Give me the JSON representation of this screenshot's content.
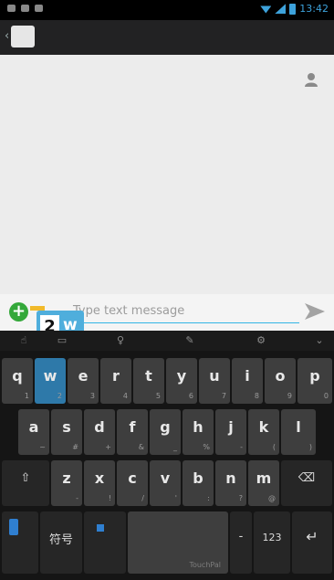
{
  "status_bar": {
    "time": "13:42",
    "icons": [
      "notification-icon",
      "image-icon",
      "sd-card-icon",
      "wifi-icon",
      "signal-icon",
      "battery-icon"
    ]
  },
  "action_bar": {
    "icons": [
      "back-chevron-icon",
      "messaging-app-icon"
    ]
  },
  "message_area": {
    "contact_icon": "contact-person-icon"
  },
  "compose": {
    "placeholder": "Type text message",
    "add_icon": "plus-icon",
    "send_icon": "send-icon",
    "attach_icon": "attachment-icon"
  },
  "key_popup": {
    "number": "2",
    "letter": "w"
  },
  "keyboard": {
    "toolbar_icons": [
      "cursor-icon",
      "layout-icon",
      "microphone-icon",
      "pencil-icon",
      "settings-icon",
      "hide-keyboard-icon"
    ],
    "row1": [
      {
        "main": "q",
        "sub": "1"
      },
      {
        "main": "w",
        "sub": "2"
      },
      {
        "main": "e",
        "sub": "3"
      },
      {
        "main": "r",
        "sub": "4"
      },
      {
        "main": "t",
        "sub": "5"
      },
      {
        "main": "y",
        "sub": "6"
      },
      {
        "main": "u",
        "sub": "7"
      },
      {
        "main": "i",
        "sub": "8"
      },
      {
        "main": "o",
        "sub": "9"
      },
      {
        "main": "p",
        "sub": "0"
      }
    ],
    "row2": [
      {
        "main": "a",
        "sub": "~"
      },
      {
        "main": "s",
        "sub": "#"
      },
      {
        "main": "d",
        "sub": "+"
      },
      {
        "main": "f",
        "sub": "&"
      },
      {
        "main": "g",
        "sub": "_"
      },
      {
        "main": "h",
        "sub": "%"
      },
      {
        "main": "j",
        "sub": "-"
      },
      {
        "main": "k",
        "sub": "("
      },
      {
        "main": "l",
        "sub": ")"
      }
    ],
    "row3": [
      {
        "main": "⇧",
        "sub": ""
      },
      {
        "main": "z",
        "sub": "-"
      },
      {
        "main": "x",
        "sub": "!"
      },
      {
        "main": "c",
        "sub": "/"
      },
      {
        "main": "v",
        "sub": "'"
      },
      {
        "main": "b",
        "sub": ":"
      },
      {
        "main": "n",
        "sub": "?"
      },
      {
        "main": "m",
        "sub": "@"
      },
      {
        "main": "⌫",
        "sub": ""
      }
    ],
    "row4": {
      "lang_icon": "language-switch-icon",
      "hangul_label": "符号",
      "hanja_icon": "input-mode-icon",
      "space_label": "TouchPal",
      "dash_label": "-",
      "numbers_label": "123",
      "enter_icon": "enter-icon"
    }
  }
}
